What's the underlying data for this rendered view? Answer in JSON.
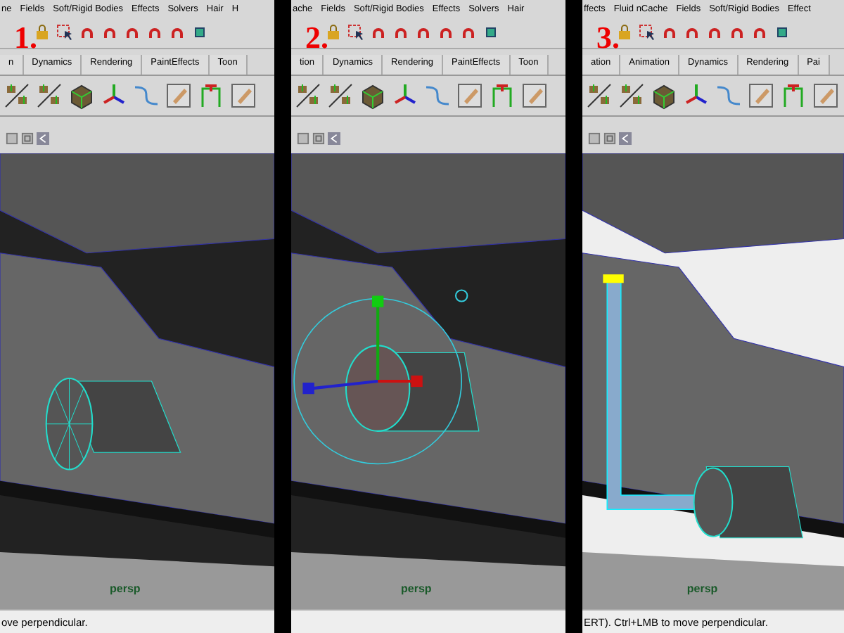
{
  "panels": [
    {
      "step": "1.",
      "kind": "wheel",
      "menu": [
        "ne",
        "Fields",
        "Soft/Rigid Bodies",
        "Effects",
        "Solvers",
        "Hair",
        "H"
      ],
      "tabs": [
        "n",
        "Dynamics",
        "Rendering",
        "PaintEffects",
        "Toon"
      ],
      "camera": "persp",
      "help": "ove perpendicular."
    },
    {
      "step": "2.",
      "kind": "gizmo",
      "menu": [
        "ache",
        "Fields",
        "Soft/Rigid Bodies",
        "Effects",
        "Solvers",
        "Hair"
      ],
      "tabs": [
        "tion",
        "Dynamics",
        "Rendering",
        "PaintEffects",
        "Toon"
      ],
      "camera": "persp"
    },
    {
      "step": "3.",
      "kind": "pipe",
      "menu": [
        "ffects",
        "Fluid nCache",
        "Fields",
        "Soft/Rigid Bodies",
        "Effect"
      ],
      "tabs": [
        "ation",
        "Animation",
        "Dynamics",
        "Rendering",
        "Pai"
      ],
      "camera": "persp",
      "help": "ERT).  Ctrl+LMB to move perpendicular."
    }
  ]
}
